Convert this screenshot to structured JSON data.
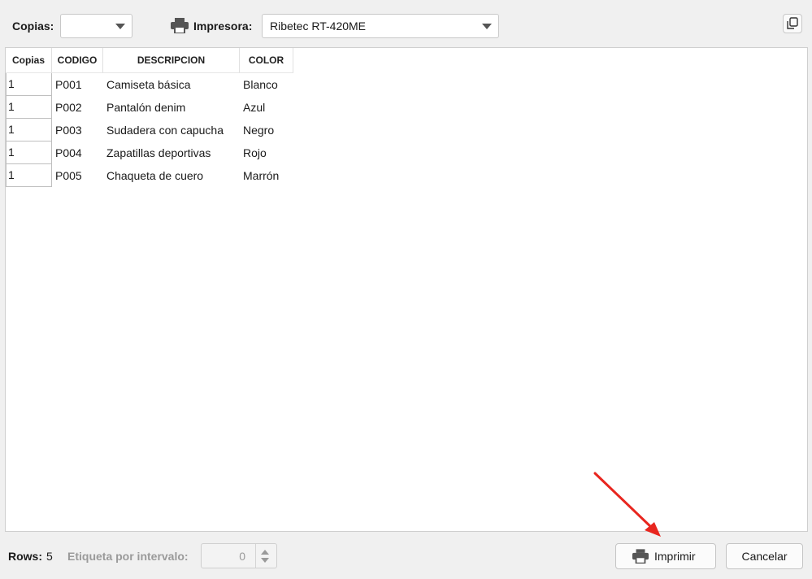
{
  "toolbar": {
    "copias_label": "Copias:",
    "copias_value": "",
    "impresora_label": "Impresora:",
    "impresora_value": "Ribetec RT-420ME"
  },
  "table": {
    "headers": [
      "Copias",
      "CODIGO",
      "DESCRIPCION",
      "COLOR"
    ],
    "rows": [
      {
        "copias": "1",
        "codigo": "P001",
        "descripcion": "Camiseta básica",
        "color": "Blanco"
      },
      {
        "copias": "1",
        "codigo": "P002",
        "descripcion": "Pantalón denim",
        "color": "Azul"
      },
      {
        "copias": "1",
        "codigo": "P003",
        "descripcion": "Sudadera con capucha",
        "color": "Negro"
      },
      {
        "copias": "1",
        "codigo": "P004",
        "descripcion": "Zapatillas deportivas",
        "color": "Rojo"
      },
      {
        "copias": "1",
        "codigo": "P005",
        "descripcion": "Chaqueta de cuero",
        "color": "Marrón"
      }
    ]
  },
  "footer": {
    "rows_label": "Rows:",
    "rows_value": "5",
    "etiqueta_label": "Etiqueta por intervalo:",
    "etiqueta_value": "0",
    "imprimir_label": "Imprimir",
    "cancelar_label": "Cancelar"
  },
  "colors": {
    "annotation_arrow": "#e8261f"
  }
}
